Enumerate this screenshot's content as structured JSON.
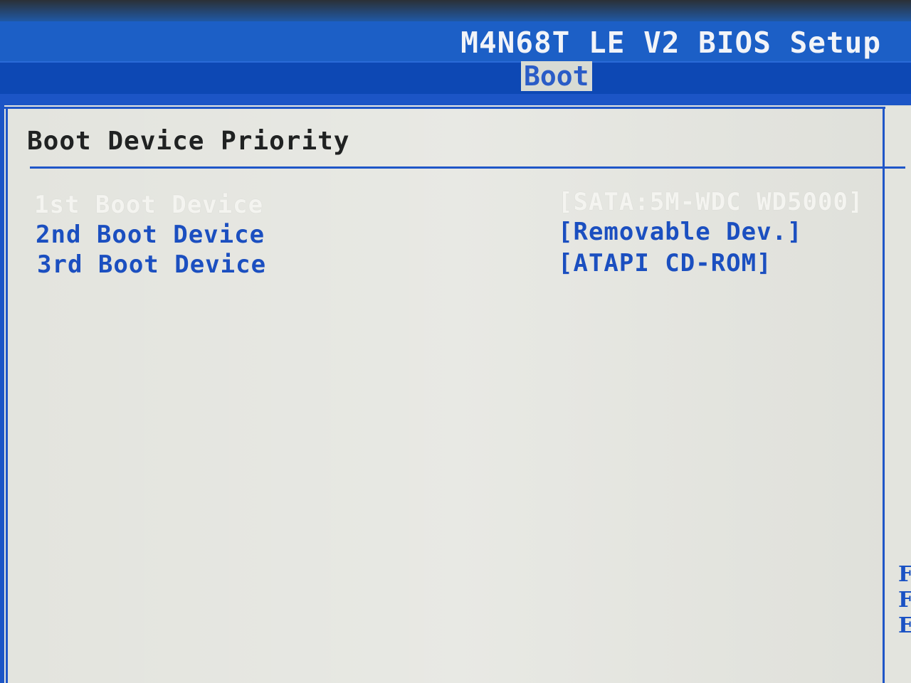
{
  "header": {
    "bios_title": "M4N68T LE V2 BIOS Setup",
    "active_tab": "Boot"
  },
  "section": {
    "title": "Boot Device Priority"
  },
  "boot_devices": [
    {
      "label": "1st Boot Device",
      "value": "[SATA:5M-WDC WD5000]",
      "selected": true
    },
    {
      "label": "2nd Boot Device",
      "value": "[Removable Dev.]",
      "selected": false
    },
    {
      "label": "3rd Boot Device",
      "value": "[ATAPI CD-ROM]",
      "selected": false
    }
  ],
  "help_column": {
    "letters": [
      "F",
      "F",
      "E"
    ]
  },
  "colors": {
    "bios_blue": "#1c5fc6",
    "panel_background": "#e3e4de",
    "item_text": "#1b4fc0",
    "selected_text": "#f4f4f0"
  }
}
